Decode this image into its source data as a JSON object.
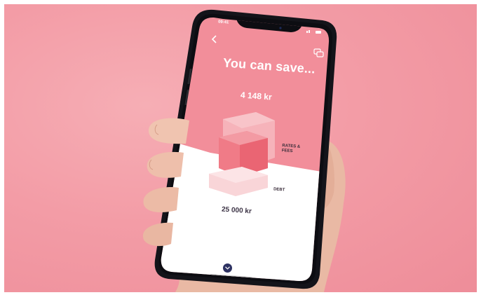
{
  "status_bar": {
    "time": "09:41"
  },
  "screen": {
    "headline": "You can save...",
    "savings_amount": "4 148 kr",
    "labels": {
      "rates_fees_line1": "RATES &",
      "rates_fees_line2": "FEES",
      "debt": "DEBT"
    },
    "debt_amount": "25 000 kr"
  },
  "icons": {
    "back": "chevron-left-icon",
    "chat": "chat-bubbles-icon",
    "scroll_down": "chevron-down-icon"
  },
  "colors": {
    "background": "#f39ca6",
    "screen_top": "#f28e9a",
    "accent_navy": "#2e3262",
    "block_dark": "#ee6c79"
  }
}
